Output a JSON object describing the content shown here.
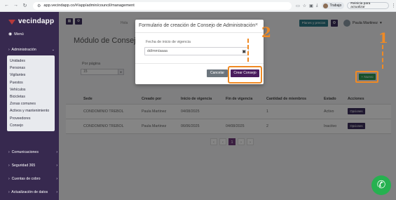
{
  "browser": {
    "url": "app.vecindapp.co/#/app/admin/council/management",
    "profile_label": "Trabajo",
    "update_label": "Reinicia para actualizar"
  },
  "sidebar": {
    "brand": "vecindapp",
    "home_label": "Menú",
    "group_label": "Administración",
    "submenu": [
      "Unidades",
      "Personas",
      "Vigilantes",
      "Puestos",
      "Vehículos",
      "Bicicletas",
      "Zonas comunes",
      "Activos y mantenimiento",
      "Proveedores",
      "Consejo"
    ],
    "lower_items": [
      "Comunicaciones",
      "Seguridad 365",
      "Cuentas de cobro",
      "Actualización de datos"
    ]
  },
  "header": {
    "plans_label": "Planes y precios",
    "user_name": "Paula Martinez",
    "faded_label": "Hola"
  },
  "page": {
    "title": "Módulo de Consejo",
    "per_page_label": "Por página",
    "per_page_value": "15",
    "new_button": "+ Nuevo",
    "columns": [
      "Sede",
      "Creado por",
      "Inicio de vigencia",
      "Fin de vigencia",
      "Cantidad de miembros",
      "Estado",
      "Acciones"
    ],
    "rows": [
      {
        "sede": "CONDOMINIO TREBOL",
        "creado_por": "Paula Martinez",
        "inicio": "04/08/2025",
        "fin": "",
        "miembros": "1",
        "estado": "Activo",
        "accion": "Opciones"
      },
      {
        "sede": "CONDOMINIO TREBOL",
        "creado_por": "Paula Martinez",
        "inicio": "06/06/2025",
        "fin": "04/08/2025",
        "miembros": "2",
        "estado": "Inactivo",
        "accion": "Opciones"
      }
    ],
    "pager": [
      "‹",
      "‹",
      "1",
      "›",
      "›"
    ]
  },
  "modal": {
    "title": "Formulario de creación de Consejo de Administración",
    "field_label": "Fecha de inicio de vigencia",
    "date_placeholder": "dd/mm/aaaa",
    "cancel_label": "Cancelar",
    "create_label": "Crear Consejo"
  },
  "annotations": {
    "step1": "1",
    "step2": "2"
  },
  "colors": {
    "sidebar": "#37294f",
    "accent_purple": "#4a1d5e",
    "annotation": "#f08a24",
    "new_button": "#2d9b52"
  }
}
